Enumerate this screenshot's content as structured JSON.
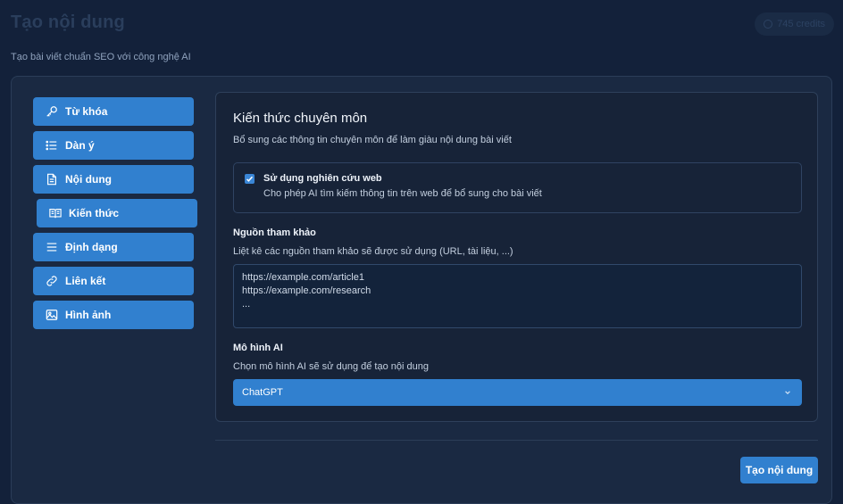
{
  "header": {
    "title": "Tạo nội dung",
    "subtitle": "Tạo bài viết chuẩn SEO với công nghệ AI",
    "credits": "745 credits"
  },
  "sidebar": {
    "items": [
      {
        "label": "Từ khóa",
        "icon": "key-icon"
      },
      {
        "label": "Dàn ý",
        "icon": "list-icon"
      },
      {
        "label": "Nội dung",
        "icon": "document-icon"
      },
      {
        "label": "Kiến thức",
        "icon": "book-icon",
        "active": true
      },
      {
        "label": "Định dạng",
        "icon": "format-icon"
      },
      {
        "label": "Liên kết",
        "icon": "link-icon"
      },
      {
        "label": "Hình ảnh",
        "icon": "image-icon"
      }
    ]
  },
  "panel": {
    "title": "Kiến thức chuyên môn",
    "description": "Bổ sung các thông tin chuyên môn để làm giàu nội dung bài viết",
    "web_research": {
      "checked": true,
      "label": "Sử dụng nghiên cứu web",
      "description": "Cho phép AI tìm kiếm thông tin trên web để bổ sung cho bài viết"
    },
    "references": {
      "label": "Nguồn tham khảo",
      "description": "Liệt kê các nguồn tham khảo sẽ được sử dụng (URL, tài liệu, ...)",
      "placeholder_lines": [
        "https://example.com/article1",
        "https://example.com/research",
        "..."
      ]
    },
    "ai_model": {
      "label": "Mô hình AI",
      "description": "Chọn mô hình AI sẽ sử dụng để tạo nội dung",
      "selected": "ChatGPT"
    }
  },
  "submit_label": "Tạo nội dung",
  "colors": {
    "background": "#13213a",
    "card": "#1a2942",
    "accent": "#3180cf"
  }
}
